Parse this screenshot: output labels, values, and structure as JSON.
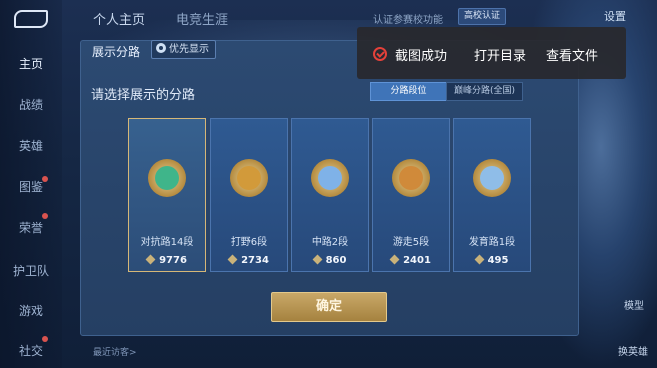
{
  "top_tabs": {
    "tab1": "个人主页",
    "tab2": "电竞生涯"
  },
  "top_bar": {
    "cert_text": "认证参赛校功能",
    "cert_badge": "高校认证",
    "settings": "设置"
  },
  "sidebar": {
    "items": [
      "主页",
      "战绩",
      "英雄",
      "图鉴",
      "荣誉",
      "护卫队",
      "游戏",
      "社交"
    ]
  },
  "right_labels": {
    "model": "模型",
    "change_hero": "换英雄"
  },
  "dialog": {
    "title": "展示分路",
    "priority_button": "优先显示",
    "subtitle": "请选择展示的分路",
    "segments": {
      "active": "分路段位",
      "inactive": "巅峰分路(全国)"
    },
    "lanes": [
      {
        "label": "对抗路14段",
        "score": "9776",
        "selected": true,
        "color": "#3fb58a"
      },
      {
        "label": "打野6段",
        "score": "2734",
        "selected": false,
        "color": "#d29a3a"
      },
      {
        "label": "中路2段",
        "score": "860",
        "selected": false,
        "color": "#7fb2e8"
      },
      {
        "label": "游走5段",
        "score": "2401",
        "selected": false,
        "color": "#d08a3a"
      },
      {
        "label": "发育路1段",
        "score": "495",
        "selected": false,
        "color": "#8fbde8"
      }
    ],
    "confirm": "确定"
  },
  "toast": {
    "message": "截图成功",
    "open_dir": "打开目录",
    "view_file": "查看文件"
  },
  "bottom": {
    "text": "最近访客>"
  }
}
